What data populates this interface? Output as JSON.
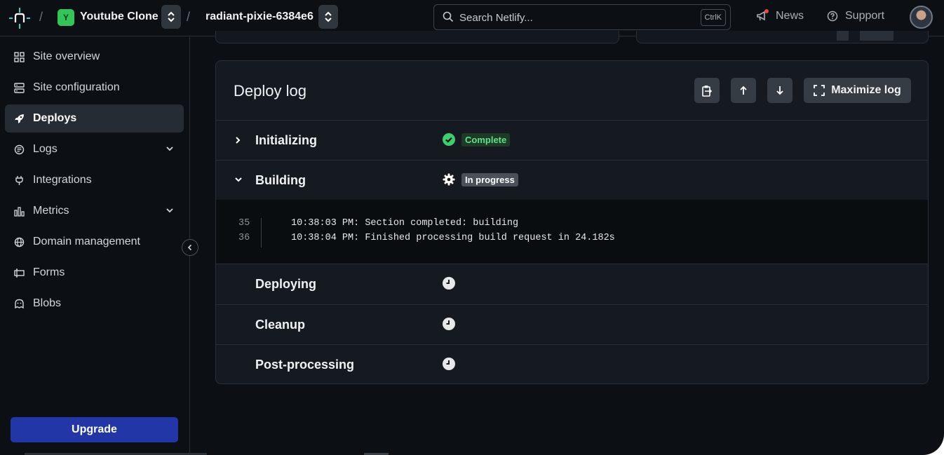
{
  "header": {
    "team_initial": "Y",
    "team_name": "Youtube Clone",
    "site_name": "radiant-pixie-6384e6",
    "search_placeholder": "Search Netlify...",
    "search_shortcut": "CtrlK",
    "news_label": "News",
    "support_label": "Support"
  },
  "sidebar": {
    "items": [
      {
        "label": "Site overview",
        "icon": "grid-icon"
      },
      {
        "label": "Site configuration",
        "icon": "config-icon"
      },
      {
        "label": "Deploys",
        "icon": "rocket-icon",
        "active": true
      },
      {
        "label": "Logs",
        "icon": "logs-icon",
        "expandable": true
      },
      {
        "label": "Integrations",
        "icon": "plug-icon"
      },
      {
        "label": "Metrics",
        "icon": "bar-chart-icon",
        "expandable": true
      },
      {
        "label": "Domain management",
        "icon": "globe-icon"
      },
      {
        "label": "Forms",
        "icon": "form-icon"
      },
      {
        "label": "Blobs",
        "icon": "blob-icon"
      }
    ],
    "upgrade_label": "Upgrade"
  },
  "deploy_log": {
    "title": "Deploy log",
    "maximize_label": "Maximize log",
    "steps": [
      {
        "name": "Initializing",
        "status": "Complete",
        "state": "complete",
        "expanded": false
      },
      {
        "name": "Building",
        "status": "In progress",
        "state": "progress",
        "expanded": true
      },
      {
        "name": "Deploying",
        "status": "",
        "state": "pending"
      },
      {
        "name": "Cleanup",
        "status": "",
        "state": "pending"
      },
      {
        "name": "Post-processing",
        "status": "",
        "state": "pending"
      }
    ],
    "log_lines": [
      {
        "num": "35",
        "text": "10:38:03 PM: Section completed: building"
      },
      {
        "num": "36",
        "text": "10:38:04 PM: Finished processing build request in 24.182s"
      }
    ]
  },
  "colors": {
    "background": "#0c1014",
    "accent_upgrade": "#2236a8",
    "complete_green": "#63e08a",
    "team_badge": "#32c55a"
  }
}
